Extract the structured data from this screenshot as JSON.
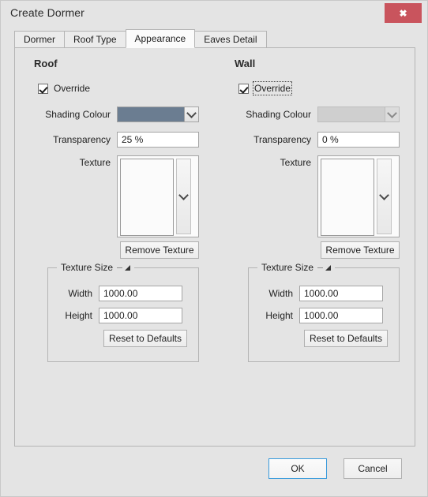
{
  "window": {
    "title": "Create Dormer",
    "close_label": "✖"
  },
  "tabs": [
    {
      "label": "Dormer",
      "selected": false
    },
    {
      "label": "Roof Type",
      "selected": false
    },
    {
      "label": "Appearance",
      "selected": true
    },
    {
      "label": "Eaves Detail",
      "selected": false
    }
  ],
  "columns": {
    "roof": {
      "section_title": "Roof",
      "override_label": "Override",
      "override_checked": true,
      "override_focused": false,
      "shading_colour_label": "Shading Colour",
      "shading_colour_value": "#6b7d91",
      "shading_colour_disabled": false,
      "transparency_label": "Transparency",
      "transparency_value": "25 %",
      "texture_label": "Texture",
      "texture_kind": "roof-tiles",
      "remove_texture_label": "Remove Texture",
      "texture_size": {
        "title": "Texture Size",
        "width_label": "Width",
        "width_value": "1000.00",
        "height_label": "Height",
        "height_value": "1000.00",
        "reset_label": "Reset to Defaults"
      }
    },
    "wall": {
      "section_title": "Wall",
      "override_label": "Override",
      "override_checked": true,
      "override_focused": true,
      "shading_colour_label": "Shading Colour",
      "shading_colour_value": "#cfcfcf",
      "shading_colour_disabled": true,
      "transparency_label": "Transparency",
      "transparency_value": "0 %",
      "texture_label": "Texture",
      "texture_kind": "wall-siding",
      "remove_texture_label": "Remove Texture",
      "texture_size": {
        "title": "Texture Size",
        "width_label": "Width",
        "width_value": "1000.00",
        "height_label": "Height",
        "height_value": "1000.00",
        "reset_label": "Reset to Defaults"
      }
    }
  },
  "footer": {
    "ok_label": "OK",
    "cancel_label": "Cancel"
  },
  "theme": {
    "dialog_bg": "#e4e4e4",
    "close_red": "#c9545d",
    "default_button_blue": "#3a9bdc",
    "roof_swatch": "#6b7d91"
  }
}
